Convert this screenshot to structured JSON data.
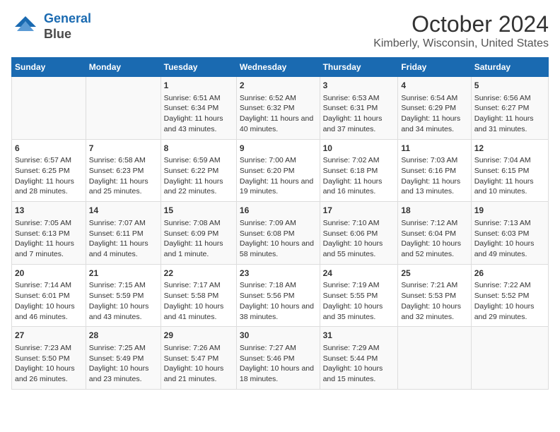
{
  "header": {
    "logo_line1": "General",
    "logo_line2": "Blue",
    "title": "October 2024",
    "subtitle": "Kimberly, Wisconsin, United States"
  },
  "days_of_week": [
    "Sunday",
    "Monday",
    "Tuesday",
    "Wednesday",
    "Thursday",
    "Friday",
    "Saturday"
  ],
  "weeks": [
    [
      {
        "day": "",
        "content": ""
      },
      {
        "day": "",
        "content": ""
      },
      {
        "day": "1",
        "content": "Sunrise: 6:51 AM\nSunset: 6:34 PM\nDaylight: 11 hours and 43 minutes."
      },
      {
        "day": "2",
        "content": "Sunrise: 6:52 AM\nSunset: 6:32 PM\nDaylight: 11 hours and 40 minutes."
      },
      {
        "day": "3",
        "content": "Sunrise: 6:53 AM\nSunset: 6:31 PM\nDaylight: 11 hours and 37 minutes."
      },
      {
        "day": "4",
        "content": "Sunrise: 6:54 AM\nSunset: 6:29 PM\nDaylight: 11 hours and 34 minutes."
      },
      {
        "day": "5",
        "content": "Sunrise: 6:56 AM\nSunset: 6:27 PM\nDaylight: 11 hours and 31 minutes."
      }
    ],
    [
      {
        "day": "6",
        "content": "Sunrise: 6:57 AM\nSunset: 6:25 PM\nDaylight: 11 hours and 28 minutes."
      },
      {
        "day": "7",
        "content": "Sunrise: 6:58 AM\nSunset: 6:23 PM\nDaylight: 11 hours and 25 minutes."
      },
      {
        "day": "8",
        "content": "Sunrise: 6:59 AM\nSunset: 6:22 PM\nDaylight: 11 hours and 22 minutes."
      },
      {
        "day": "9",
        "content": "Sunrise: 7:00 AM\nSunset: 6:20 PM\nDaylight: 11 hours and 19 minutes."
      },
      {
        "day": "10",
        "content": "Sunrise: 7:02 AM\nSunset: 6:18 PM\nDaylight: 11 hours and 16 minutes."
      },
      {
        "day": "11",
        "content": "Sunrise: 7:03 AM\nSunset: 6:16 PM\nDaylight: 11 hours and 13 minutes."
      },
      {
        "day": "12",
        "content": "Sunrise: 7:04 AM\nSunset: 6:15 PM\nDaylight: 11 hours and 10 minutes."
      }
    ],
    [
      {
        "day": "13",
        "content": "Sunrise: 7:05 AM\nSunset: 6:13 PM\nDaylight: 11 hours and 7 minutes."
      },
      {
        "day": "14",
        "content": "Sunrise: 7:07 AM\nSunset: 6:11 PM\nDaylight: 11 hours and 4 minutes."
      },
      {
        "day": "15",
        "content": "Sunrise: 7:08 AM\nSunset: 6:09 PM\nDaylight: 11 hours and 1 minute."
      },
      {
        "day": "16",
        "content": "Sunrise: 7:09 AM\nSunset: 6:08 PM\nDaylight: 10 hours and 58 minutes."
      },
      {
        "day": "17",
        "content": "Sunrise: 7:10 AM\nSunset: 6:06 PM\nDaylight: 10 hours and 55 minutes."
      },
      {
        "day": "18",
        "content": "Sunrise: 7:12 AM\nSunset: 6:04 PM\nDaylight: 10 hours and 52 minutes."
      },
      {
        "day": "19",
        "content": "Sunrise: 7:13 AM\nSunset: 6:03 PM\nDaylight: 10 hours and 49 minutes."
      }
    ],
    [
      {
        "day": "20",
        "content": "Sunrise: 7:14 AM\nSunset: 6:01 PM\nDaylight: 10 hours and 46 minutes."
      },
      {
        "day": "21",
        "content": "Sunrise: 7:15 AM\nSunset: 5:59 PM\nDaylight: 10 hours and 43 minutes."
      },
      {
        "day": "22",
        "content": "Sunrise: 7:17 AM\nSunset: 5:58 PM\nDaylight: 10 hours and 41 minutes."
      },
      {
        "day": "23",
        "content": "Sunrise: 7:18 AM\nSunset: 5:56 PM\nDaylight: 10 hours and 38 minutes."
      },
      {
        "day": "24",
        "content": "Sunrise: 7:19 AM\nSunset: 5:55 PM\nDaylight: 10 hours and 35 minutes."
      },
      {
        "day": "25",
        "content": "Sunrise: 7:21 AM\nSunset: 5:53 PM\nDaylight: 10 hours and 32 minutes."
      },
      {
        "day": "26",
        "content": "Sunrise: 7:22 AM\nSunset: 5:52 PM\nDaylight: 10 hours and 29 minutes."
      }
    ],
    [
      {
        "day": "27",
        "content": "Sunrise: 7:23 AM\nSunset: 5:50 PM\nDaylight: 10 hours and 26 minutes."
      },
      {
        "day": "28",
        "content": "Sunrise: 7:25 AM\nSunset: 5:49 PM\nDaylight: 10 hours and 23 minutes."
      },
      {
        "day": "29",
        "content": "Sunrise: 7:26 AM\nSunset: 5:47 PM\nDaylight: 10 hours and 21 minutes."
      },
      {
        "day": "30",
        "content": "Sunrise: 7:27 AM\nSunset: 5:46 PM\nDaylight: 10 hours and 18 minutes."
      },
      {
        "day": "31",
        "content": "Sunrise: 7:29 AM\nSunset: 5:44 PM\nDaylight: 10 hours and 15 minutes."
      },
      {
        "day": "",
        "content": ""
      },
      {
        "day": "",
        "content": ""
      }
    ]
  ]
}
